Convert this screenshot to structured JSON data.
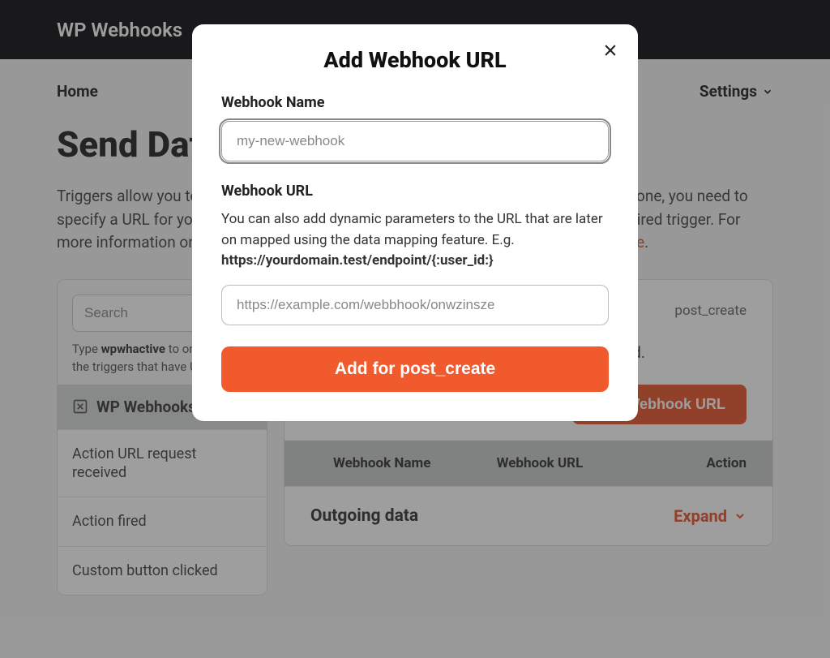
{
  "topbar": {
    "title": "WP Webhooks"
  },
  "nav": {
    "home": "Home",
    "settings": "Settings"
  },
  "page": {
    "title": "Send Data",
    "desc_before": "Triggers allow you to send data on a specific event (e.g., when a user logs in). To use one, you need to specify a URL for your receiving endpoint, which you can set up by clicking on the desired trigger. For more information on each of the available triggers, you can also check out ",
    "desc_link": "our website",
    "desc_after": "."
  },
  "sidebar": {
    "search_placeholder": "Search",
    "help_before": "Type ",
    "help_bold": "wpwhactive",
    "help_after": " to only show the triggers that have URLs.",
    "section": "WP Webhooks",
    "items": [
      "Action URL request received",
      "Action fired",
      "Custom button clicked"
    ]
  },
  "main": {
    "badge": "post_create",
    "desc": "This webhook fires after a new post was created.",
    "add_btn": "Add Webhook URL",
    "cols": {
      "name": "Webhook Name",
      "url": "Webhook URL",
      "action": "Action"
    },
    "outgoing": "Outgoing data",
    "expand": "Expand"
  },
  "modal": {
    "title": "Add Webhook URL",
    "name_label": "Webhook Name",
    "name_placeholder": "my-new-webhook",
    "url_label": "Webhook URL",
    "url_help_before": "You can also add dynamic parameters to the URL that are later on mapped using the data mapping feature. E.g. ",
    "url_help_bold": "https://yourdomain.test/endpoint/{:user_id:}",
    "url_placeholder": "https://example.com/webbhook/onwzinsze",
    "submit": "Add for post_create"
  }
}
